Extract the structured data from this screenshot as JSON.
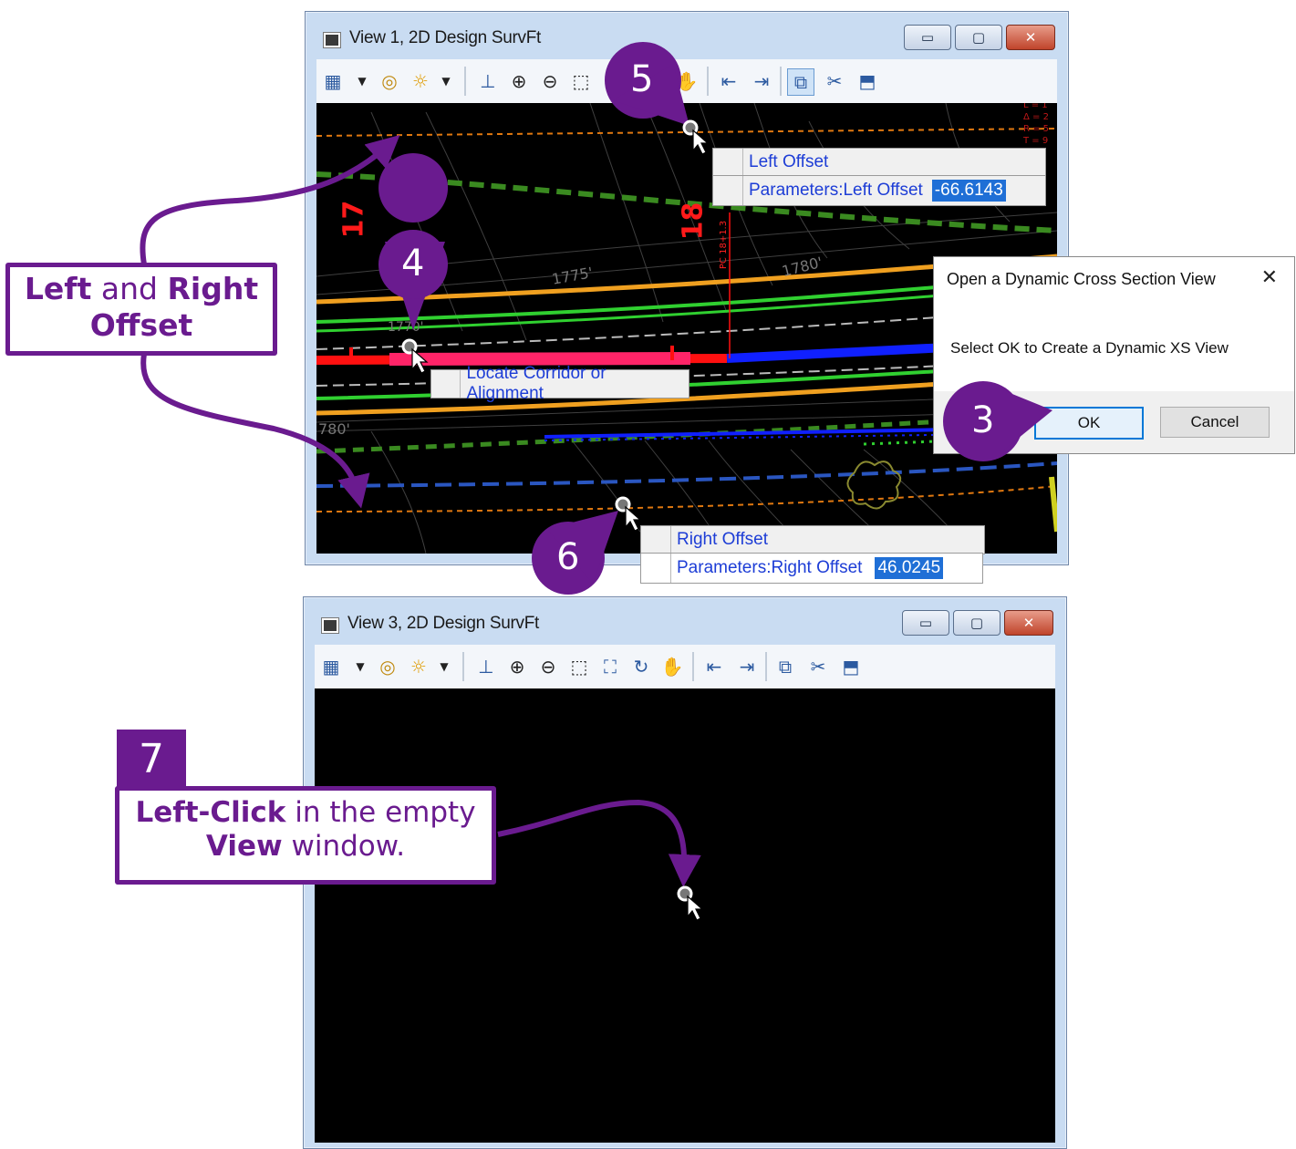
{
  "view1": {
    "title": "View 1, 2D Design SurvFt",
    "window_controls": {
      "minimize": "▭",
      "maximize": "▢",
      "close": "✕"
    },
    "canvas_labels": {
      "station_17": "17",
      "station_18": "18",
      "pc_label": "PC 18+1.3",
      "contour_1775": "1775'",
      "contour_1780a": "1780'",
      "contour_1780b": "780'",
      "contour_1770": "1770'"
    }
  },
  "view3": {
    "title": "View 3, 2D Design SurvFt",
    "window_controls": {
      "minimize": "▭",
      "maximize": "▢",
      "close": "✕"
    }
  },
  "prompts": {
    "left_offset": {
      "title": "Left Offset",
      "label": "Parameters:Left Offset",
      "value": "-66.6143"
    },
    "right_offset": {
      "title": "Right Offset",
      "label": "Parameters:Right Offset",
      "value": "46.0245"
    },
    "locate": {
      "label": "Locate Corridor or Alignment"
    }
  },
  "dialog": {
    "title": "Open a Dynamic Cross Section View",
    "close": "✕",
    "message": "Select OK to Create a Dynamic XS View",
    "ok_label": "OK",
    "cancel_label": "Cancel"
  },
  "callouts": {
    "offsets": {
      "bold1": "Left",
      "plain1": " and ",
      "bold2": "Right",
      "bold3": "Offset"
    },
    "left_click": {
      "bold1": "Left-Click",
      "plain1": " in the empty",
      "bold2": "View",
      "plain2": " window."
    }
  },
  "steps": {
    "s3": "3",
    "s4": "4",
    "s5": "5",
    "s6": "6",
    "s7": "7"
  },
  "colors": {
    "annotation_purple": "#6a1b8f",
    "prompt_text": "#1d3dd6",
    "selection_blue": "#1f6fd6"
  }
}
